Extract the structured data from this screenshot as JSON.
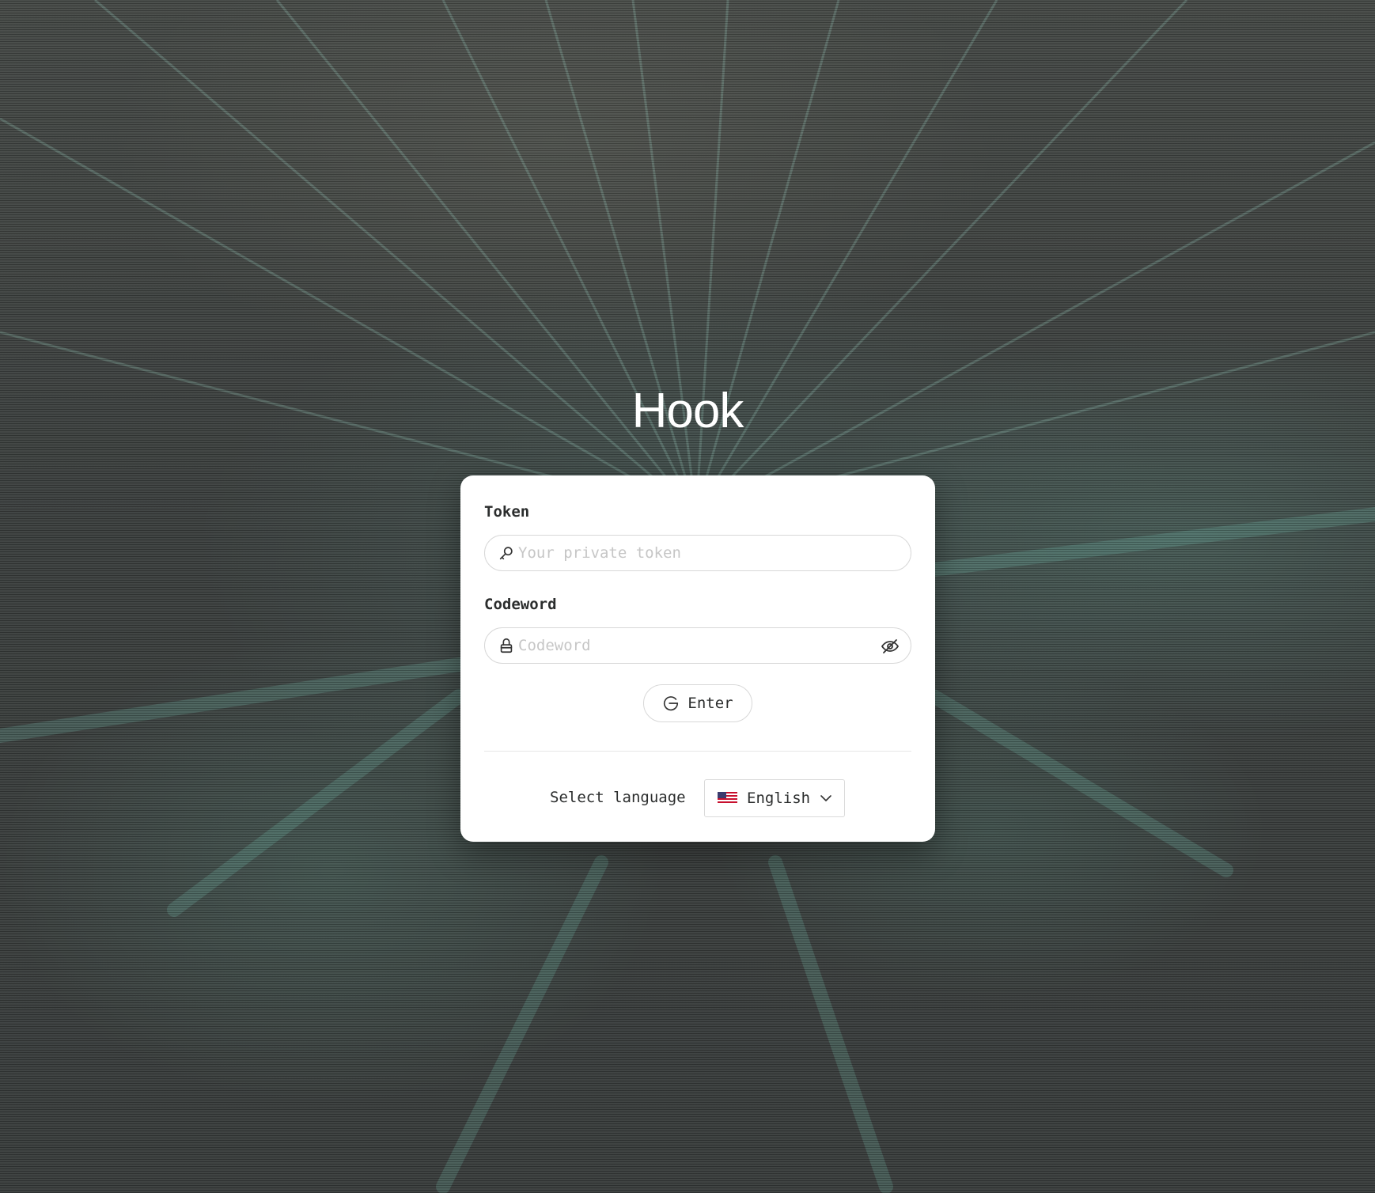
{
  "app": {
    "title": "Hook"
  },
  "form": {
    "token": {
      "label": "Token",
      "placeholder": "Your private token",
      "value": "",
      "icon": "key-icon"
    },
    "codeword": {
      "label": "Codeword",
      "placeholder": "Codeword",
      "value": "",
      "icon": "lock-icon",
      "toggle_icon": "eye-off-icon"
    },
    "submit": {
      "label": "Enter",
      "icon": "login-icon"
    }
  },
  "language": {
    "label": "Select language",
    "selected": "English",
    "flag": "us-flag-icon"
  },
  "colors": {
    "card": "#ffffff",
    "text": "#2b2d2d",
    "placeholder": "#c6c6c6",
    "border": "#d8d8d8",
    "background": "#3e4341",
    "accent": "#6fb7a6"
  }
}
